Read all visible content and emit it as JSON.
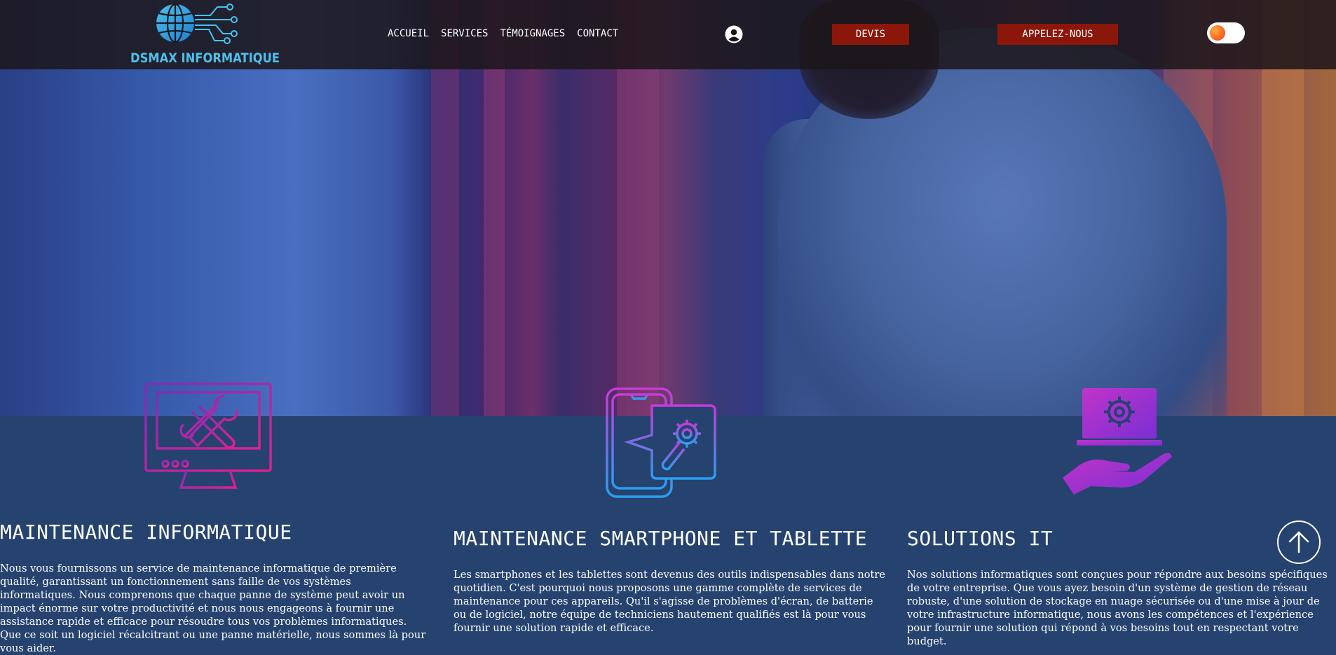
{
  "brand": {
    "name": "DSMAX INFORMATIQUE",
    "logo_icon": "globe-circuit-icon",
    "accent": "#4ec0ea"
  },
  "nav": {
    "items": [
      {
        "label": "ACCUEIL"
      },
      {
        "label": "SERVICES"
      },
      {
        "label": "TÉMOIGNAGES"
      },
      {
        "label": "CONTACT"
      }
    ]
  },
  "header": {
    "user_icon": "user-circle-icon",
    "devis_label": "DEVIS",
    "call_label": "APPELEZ-NOUS",
    "button_color": "#8a1709",
    "theme_toggle": "theme-toggle"
  },
  "services": [
    {
      "icon": "monitor-tools-icon",
      "title": "MAINTENANCE INFORMATIQUE",
      "text": "Nous vous fournissons un service de maintenance informatique de première qualité, garantissant un fonctionnement sans faille de vos systèmes informatiques. Nous comprenons que chaque panne de système peut avoir un impact énorme sur votre productivité et nous nous engageons à fournir une assistance rapide et efficace pour résoudre tous vos problèmes informatiques. Que ce soit un logiciel récalcitrant ou une panne matérielle, nous sommes là pour vous aider."
    },
    {
      "icon": "phone-tablet-repair-icon",
      "title": "MAINTENANCE SMARTPHONE ET TABLETTE",
      "text": "Les smartphones et les tablettes sont devenus des outils indispensables dans notre quotidien. C'est pourquoi nous proposons une gamme complète de services de maintenance pour ces appareils. Qu'il s'agisse de problèmes d'écran, de batterie ou de logiciel, notre équipe de techniciens hautement qualifiés est là pour vous fournir une solution rapide et efficace."
    },
    {
      "icon": "laptop-gear-hand-icon",
      "title": "SOLUTIONS IT",
      "text": "Nos solutions informatiques sont conçues pour répondre aux besoins spécifiques de votre entreprise. Que vous ayez besoin d'un système de gestion de réseau robuste, d'une solution de stockage en nuage sécurisée ou d'une mise à jour de votre infrastructure informatique, nous avons les compétences et l'expérience pour fournir une solution qui répond à vos besoins tout en respectant votre budget."
    }
  ],
  "scroll_top_icon": "arrow-up-circle-icon",
  "colors": {
    "section_bg": "#26426f",
    "header_bg": "#1c161a"
  }
}
